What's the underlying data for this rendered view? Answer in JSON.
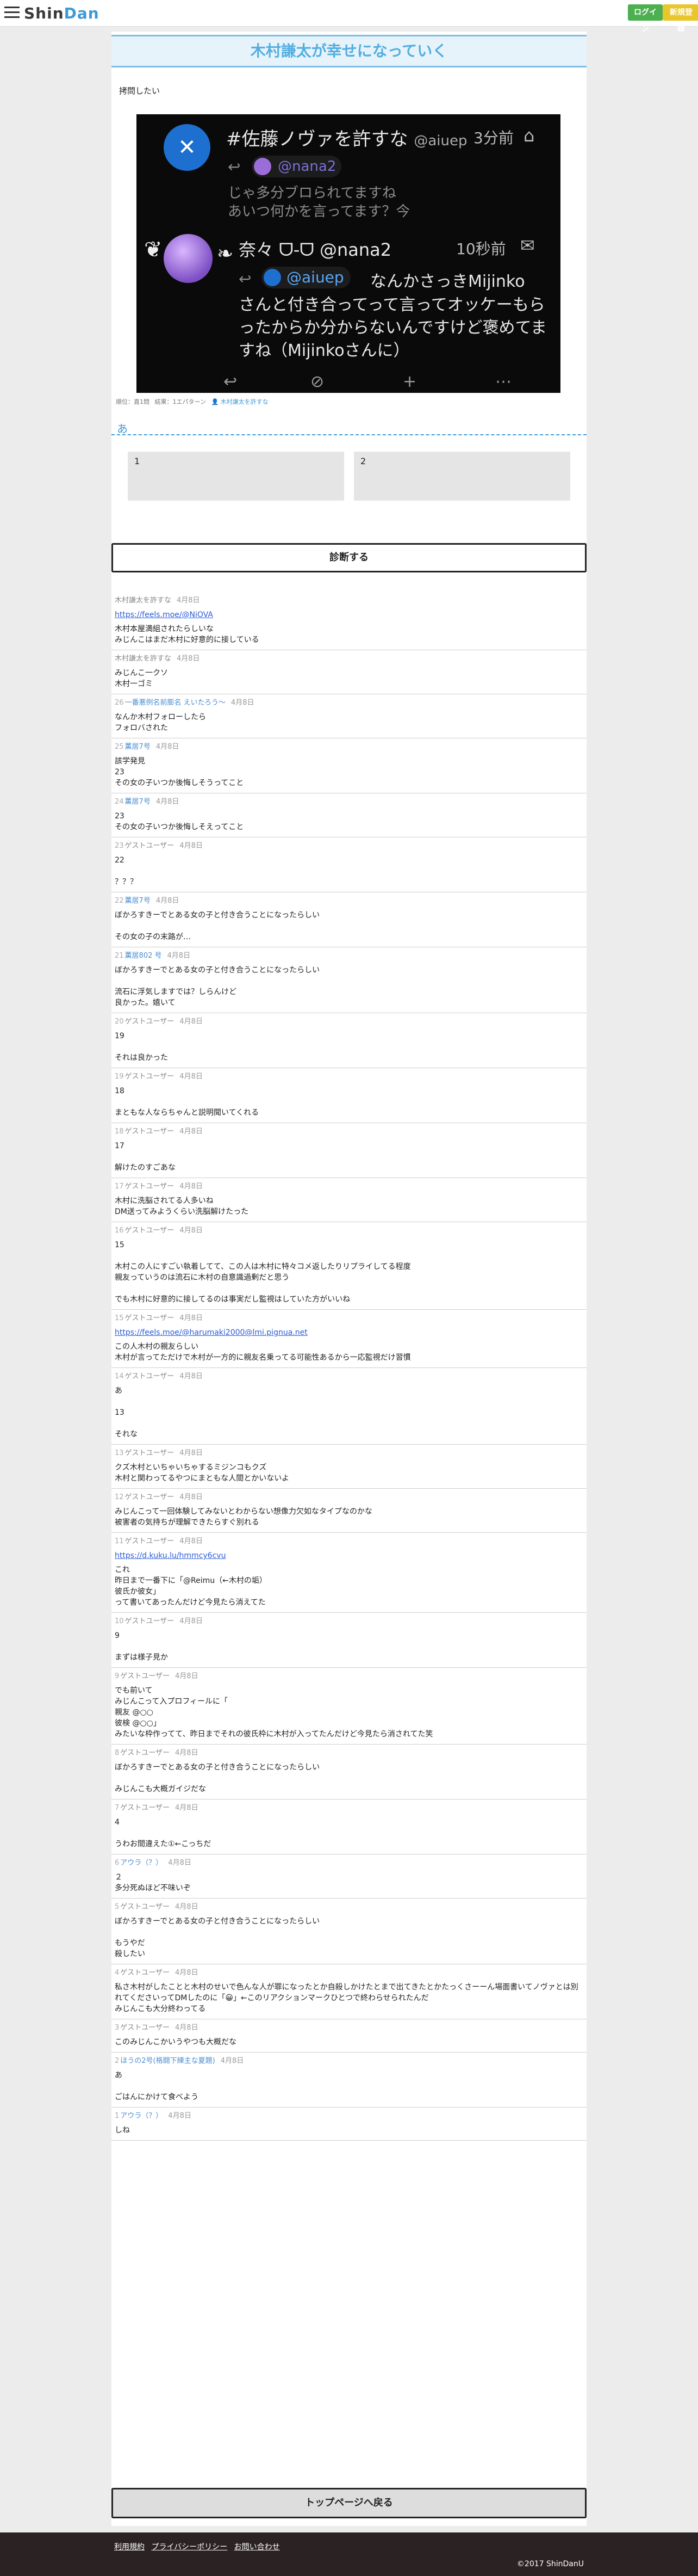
{
  "header": {
    "logo_part1": "Shin",
    "logo_part2": "Dan",
    "login_label": "ログイン",
    "register_label": "新規登録"
  },
  "page": {
    "title": "木村謙太が幸せになっていく",
    "lead": "拷問したい"
  },
  "tweet": {
    "user1_name": "#佐藤ノヴァを許すな",
    "user1_handle": "@aiuep",
    "user1_time": "3分前",
    "user1_mention": "@nana2",
    "user1_text_line1": "じゃ多分ブロられてますね",
    "user1_text_line2": "あいつ何かを言ってます？今",
    "user2_name": "奈々 ᗜ-ᗜ @nana2",
    "user2_time": "10秒前",
    "user2_mention": "@aiuep",
    "user2_inline": "なんかさっきMijinko",
    "user2_text": "さんと付き合ってって言ってオッケーもらったからか分からないんですけど褒めてますね（Mijinkoさんに）"
  },
  "meta": {
    "rank": "順位：直1問",
    "result": "結果：1エパターン",
    "author": "木村謙太を許すな"
  },
  "result": {
    "heading": "あ",
    "box1": "1",
    "box2": "2"
  },
  "diagnose_label": "診断する",
  "comments": [
    {
      "num": "",
      "user": "木村謙太を許すな",
      "user_link": false,
      "date": "4月8日",
      "body": "",
      "link": "https://feels.moe/@NiOVA",
      "body2": "木村本屋満組されたらしいな\nみじんこはまだ木村に好意的に接している"
    },
    {
      "num": "",
      "user": "木村謙太を許すな",
      "user_link": false,
      "date": "4月8日",
      "body": "みじんこ一クソ\n木村一ゴミ",
      "link": "",
      "body2": ""
    },
    {
      "num": "26",
      "user": "一番悪例名前膨名 えいたろう～",
      "user_link": true,
      "date": "4月8日",
      "body": "なんか木村フォローしたら\nフォロバされた",
      "link": "",
      "body2": ""
    },
    {
      "num": "25",
      "user": "薫居7号",
      "user_link": true,
      "date": "4月8日",
      "body": "該学発見\n23\nその女の子いつか後悔しそうってこと",
      "link": "",
      "body2": ""
    },
    {
      "num": "24",
      "user": "薫居7号",
      "user_link": true,
      "date": "4月8日",
      "body": "23\nその女の子いつか後悔しそえってこと",
      "link": "",
      "body2": ""
    },
    {
      "num": "23",
      "user": "ゲストユーザー",
      "user_link": false,
      "date": "4月8日",
      "body": "22\n\n？？？",
      "link": "",
      "body2": ""
    },
    {
      "num": "22",
      "user": "薫居7号",
      "user_link": true,
      "date": "4月8日",
      "body": "ぼかろすきーでとある女の子と付き合うことになったらしい\n\nその女の子の末路が…",
      "link": "",
      "body2": ""
    },
    {
      "num": "21",
      "user": "薫居802 号",
      "user_link": true,
      "date": "4月8日",
      "body": "ぼかろすきーでとある女の子と付き合うことになったらしい\n\n流石に浮気しますでは？しらんけど\n良かった。嬉いて",
      "link": "",
      "body2": ""
    },
    {
      "num": "20",
      "user": "ゲストユーザー",
      "user_link": false,
      "date": "4月8日",
      "body": "19\n\nそれは良かった",
      "link": "",
      "body2": ""
    },
    {
      "num": "19",
      "user": "ゲストユーザー",
      "user_link": false,
      "date": "4月8日",
      "body": "18\n\nまともな人ならちゃんと説明聞いてくれる",
      "link": "",
      "body2": ""
    },
    {
      "num": "18",
      "user": "ゲストユーザー",
      "user_link": false,
      "date": "4月8日",
      "body": "17\n\n解けたのすごあな",
      "link": "",
      "body2": ""
    },
    {
      "num": "17",
      "user": "ゲストユーザー",
      "user_link": false,
      "date": "4月8日",
      "body": "木村に洗脳されてる人多いね\nDM送ってみようくらい洗脳解けたった",
      "link": "",
      "body2": ""
    },
    {
      "num": "16",
      "user": "ゲストユーザー",
      "user_link": false,
      "date": "4月8日",
      "body": "15\n\n木村この人にすごい執着してて、この人は木村に特々コメ返したりリプライしてる程度\n親友っていうのは流石に木村の自意識過剰だと思う\n\nでも木村に好意的に接してるのは事実だし監視はしていた方がいいね",
      "link": "",
      "body2": ""
    },
    {
      "num": "15",
      "user": "ゲストユーザー",
      "user_link": false,
      "date": "4月8日",
      "body": "",
      "link": "https://feels.moe/@harumaki2000@lmi.pignua.net",
      "body2": "この人木村の親友らしい\n木村が言ってただけで木村が一方的に親友名乗ってる可能性あるから一応監視だけ習慣"
    },
    {
      "num": "14",
      "user": "ゲストユーザー",
      "user_link": false,
      "date": "4月8日",
      "body": "あ\n\n13\n\nそれな",
      "link": "",
      "body2": ""
    },
    {
      "num": "13",
      "user": "ゲストユーザー",
      "user_link": false,
      "date": "4月8日",
      "body": "クズ木村といちゃいちゃするミジンコもクズ\n木村と関わってるやつにまともな人間とかいないよ",
      "link": "",
      "body2": ""
    },
    {
      "num": "12",
      "user": "ゲストユーザー",
      "user_link": false,
      "date": "4月8日",
      "body": "みじんこって一回体験してみないとわからない想像力欠如なタイプなのかな\n被害者の気持ちが理解できたらすぐ別れる",
      "link": "",
      "body2": ""
    },
    {
      "num": "11",
      "user": "ゲストユーザー",
      "user_link": false,
      "date": "4月8日",
      "body": "",
      "link": "https://d.kuku.lu/hmmcy6cvu",
      "body2": "これ\n昨日まで一番下に「@Reimu（←木村の垢）\n彼氏か彼女」\nって書いてあったんだけど今見たら消えてた"
    },
    {
      "num": "10",
      "user": "ゲストユーザー",
      "user_link": false,
      "date": "4月8日",
      "body": "9\n\nまずは様子見か",
      "link": "",
      "body2": ""
    },
    {
      "num": "9",
      "user": "ゲストユーザー",
      "user_link": false,
      "date": "4月8日",
      "body": "でも前いて\nみじんこって入プロフィールに「\n親友 @○○\n彼検 @○○」\nみたいな枠作ってて、昨日までそれの彼氏枠に木村が入ってたんだけど今見たら消されてた笑",
      "link": "",
      "body2": ""
    },
    {
      "num": "8",
      "user": "ゲストユーザー",
      "user_link": false,
      "date": "4月8日",
      "body": "ぼかろすきーでとある女の子と付き合うことになったらしい\n\nみじんこも大概ガイジだな",
      "link": "",
      "body2": ""
    },
    {
      "num": "7",
      "user": "ゲストユーザー",
      "user_link": false,
      "date": "4月8日",
      "body": "4\n\nうわお間違えた①←こっちだ",
      "link": "",
      "body2": ""
    },
    {
      "num": "6",
      "user": "アウラ（？）",
      "user_link": true,
      "date": "4月8日",
      "body": "２\n多分死ぬほど不味いぞ",
      "link": "",
      "body2": ""
    },
    {
      "num": "5",
      "user": "ゲストユーザー",
      "user_link": false,
      "date": "4月8日",
      "body": "ぼかろすきーでとある女の子と付き合うことになったらしい\n\nもうやだ\n殺したい",
      "link": "",
      "body2": ""
    },
    {
      "num": "4",
      "user": "ゲストユーザー",
      "user_link": false,
      "date": "4月8日",
      "body": "私さ木村がしたことと木村のせいで色んな人が罪になったとか自殺しかけたとまで出てきたとかたっくさーーん場面書いてノヴァとは別れてくださいってDMしたのに「😀」←このリアクションマークひとつで終わらせられたんだ\nみじんこも大分終わってる",
      "link": "",
      "body2": ""
    },
    {
      "num": "3",
      "user": "ゲストユーザー",
      "user_link": false,
      "date": "4月8日",
      "body": "このみじんこかいうやつも大概だな",
      "link": "",
      "body2": ""
    },
    {
      "num": "2",
      "user": "ほうの2号(格闘下練主な夏題)",
      "user_link": true,
      "date": "4月8日",
      "body": "あ\n\nごはんにかけて食べよう",
      "link": "",
      "body2": ""
    },
    {
      "num": "1",
      "user": "アウラ（？）",
      "user_link": true,
      "date": "4月8日",
      "body": "しね",
      "link": "",
      "body2": ""
    }
  ],
  "top_button_label": "トップページへ戻る",
  "footer": {
    "link1": "利用規約",
    "link2": "プライバシーポリシー",
    "link3": "お問い合わせ",
    "copyright": "©2017 ShinDanU"
  }
}
